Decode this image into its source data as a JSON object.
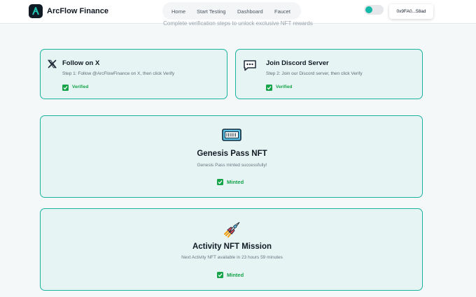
{
  "header": {
    "brand": "ArcFlow Finance",
    "nav": [
      "Home",
      "Start Testing",
      "Dashboard",
      "Faucet"
    ],
    "wallet_address": "0x9FA0...58ad"
  },
  "subtitle": "Complete verification steps to unlock exclusive NFT rewards",
  "tasks": [
    {
      "icon": "x-logo-icon",
      "title": "Follow on X",
      "description": "Step 1: Follow @ArcFlowFinance on X, then click Verify",
      "status": "Verified"
    },
    {
      "icon": "chat-bubble-icon",
      "title": "Join Discord Server",
      "description": "Step 2: Join our Discord server, then click Verify",
      "status": "Verified"
    }
  ],
  "nfts": [
    {
      "icon": "ticket-icon",
      "title": "Genesis Pass NFT",
      "status_text": "Genesis Pass minted successfully!",
      "badge": "Minted"
    },
    {
      "icon": "rocket-icon",
      "title": "Activity NFT Mission",
      "status_text": "Next Activity NFT available in 23 hours 59 minutes",
      "badge": "Minted"
    }
  ],
  "colors": {
    "accent": "#19b3a0",
    "card_bg": "#e6f4f4",
    "success": "#16a34a"
  }
}
